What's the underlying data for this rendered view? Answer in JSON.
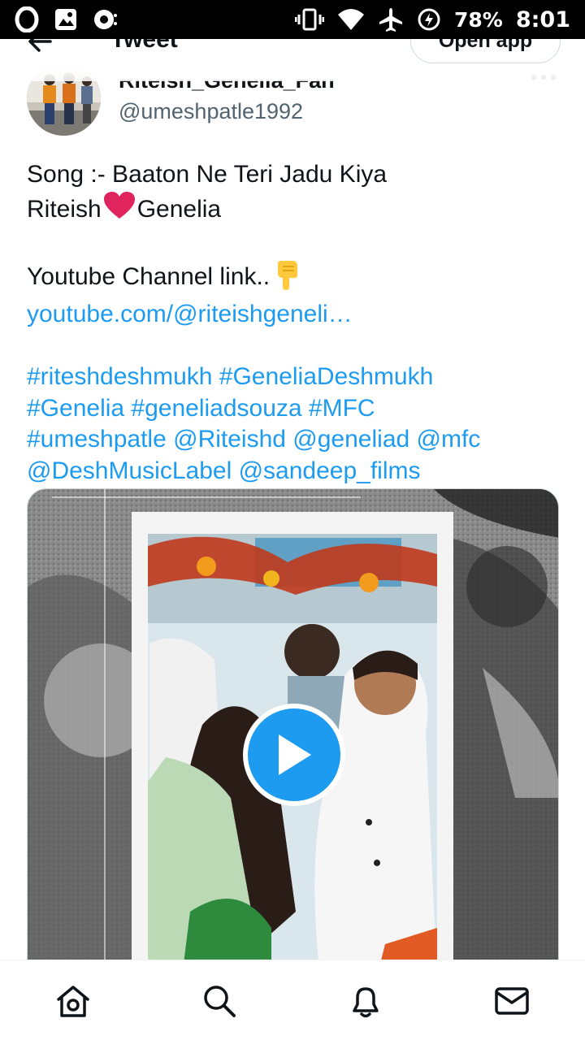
{
  "status_bar": {
    "icons": [
      "opera-icon",
      "image-icon",
      "media-icon",
      "vibrate-icon",
      "wifi-icon",
      "airplane-icon",
      "battery-saver-icon"
    ],
    "battery": "78%",
    "time": "8:01"
  },
  "header": {
    "title": "Tweet",
    "open_app": "Open app"
  },
  "author": {
    "display_name": "Riteish_Genelia_Fan",
    "handle": "@umeshpatle1992"
  },
  "tweet": {
    "line1": "Song :- Baaton Ne Teri Jadu Kiya",
    "line2_a": "Riteish",
    "line2_b": "Genelia",
    "line3": "Youtube Channel link..",
    "link": "youtube.com/@riteishgeneli…",
    "hashtags_line1": "#riteshdeshmukh #GeneliaDeshmukh",
    "hashtags_line2": "#Genelia #geneliadsouza #MFC",
    "mentions_line1": "#umeshpatle @Riteishd @geneliad @mfc",
    "mentions_line2": "@DeshMusicLabel @sandeep_films"
  },
  "colors": {
    "accent": "#1d9bf0",
    "text": "#0f1419",
    "secondary": "#536471",
    "heart": "#e0245e"
  },
  "bottom_nav": [
    "home-icon",
    "search-icon",
    "notifications-icon",
    "messages-icon"
  ]
}
